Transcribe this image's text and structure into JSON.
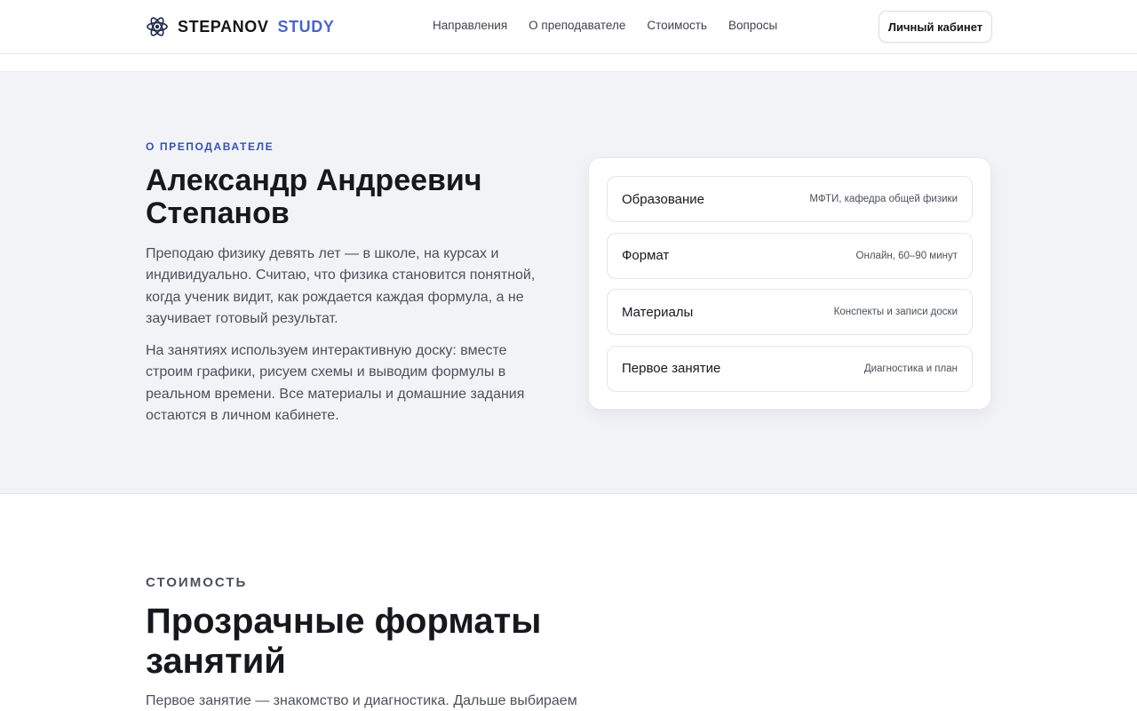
{
  "header": {
    "brand_main": "STEPANOV",
    "brand_accent": "STUDY",
    "brand_accent_color": "#4a66c9",
    "logo_icon": "atom-icon",
    "nav": [
      {
        "label": "Направления"
      },
      {
        "label": "О преподавателе"
      },
      {
        "label": "Стоимость"
      },
      {
        "label": "Вопросы"
      }
    ],
    "cabinet_label": "Личный кабинет"
  },
  "about": {
    "eyebrow": "О ПРЕПОДАВАТЕЛЕ",
    "eyebrow_color": "#3552b6",
    "title": "Александр Андреевич Степанов",
    "paragraph1": "Преподаю физику девять лет — в школе, на курсах и индивидуально. Считаю, что физика становится понятной, когда ученик видит, как рождается каждая формула, а не заучивает готовый результат.",
    "paragraph2": "На занятиях используем интерактивную доску: вместе строим графики, рисуем схемы и выводим формулы в реальном времени. Все материалы и домашние задания остаются в личном кабинете.",
    "facts": [
      {
        "label": "Образование",
        "value": "МФТИ, кафедра общей физики"
      },
      {
        "label": "Формат",
        "value": "Онлайн, 60–90 минут"
      },
      {
        "label": "Материалы",
        "value": "Конспекты и записи доски"
      },
      {
        "label": "Первое занятие",
        "value": "Диагностика и план"
      }
    ]
  },
  "pricing": {
    "eyebrow": "СТОИМОСТЬ",
    "title": "Прозрачные форматы занятий",
    "paragraph": "Первое занятие — знакомство и диагностика. Дальше выбираем"
  }
}
